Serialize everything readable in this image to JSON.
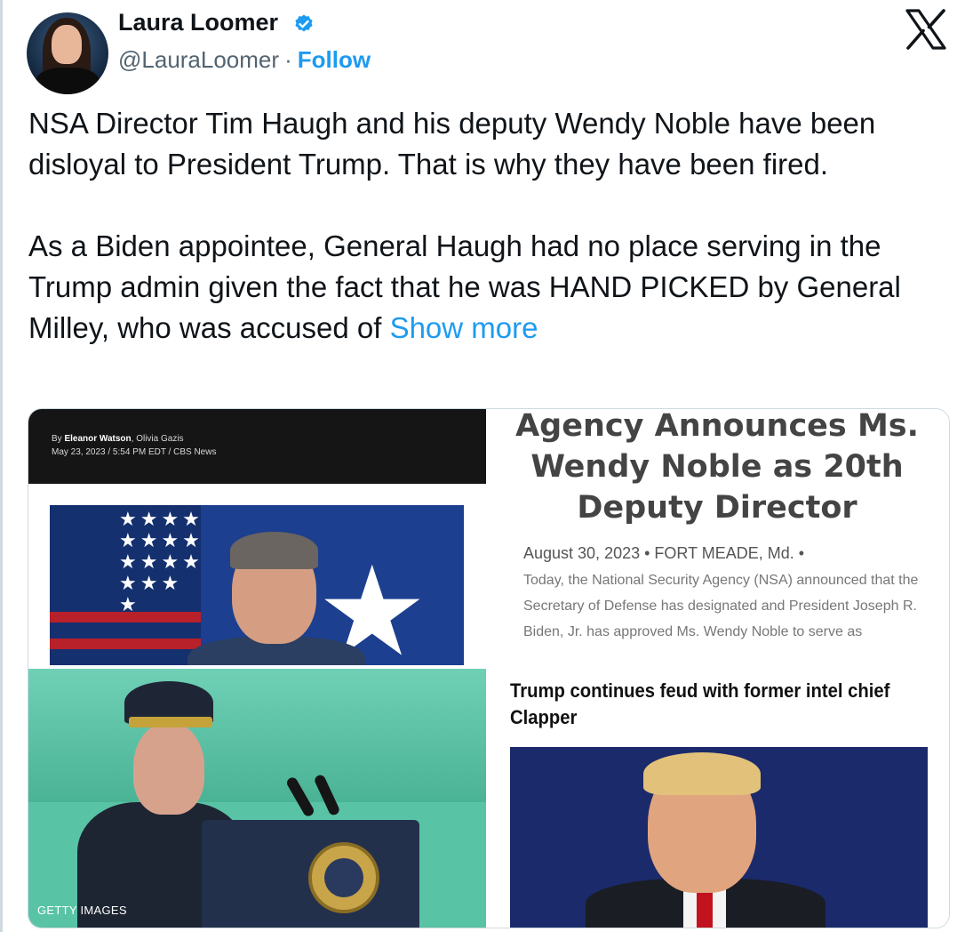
{
  "author": {
    "name": "Laura Loomer",
    "handle": "@LauraLoomer",
    "separator": "·",
    "follow_label": "Follow",
    "verified_icon": "verified-badge-icon",
    "brand_icon": "x-logo-icon",
    "link_color": "#1d9bf0"
  },
  "tweet": {
    "paragraph1": "NSA Director Tim Haugh and his deputy Wendy Noble have been disloyal to President Trump. That is why they have been fired.",
    "paragraph2": "As a Biden appointee, General Haugh had no place serving in the Trump admin given the fact that he was HAND PICKED by General Milley, who was accused of",
    "show_more_label": "Show more"
  },
  "media": {
    "panel1": {
      "byline_prefix": "By",
      "byline_authors": "Eleanor Watson",
      "byline_coauthor": ", Olivia Gazis",
      "dateline": "May 23, 2023 / 5:54 PM EDT / CBS News"
    },
    "panel2": {
      "headline": "Agency Announces Ms. Wendy Noble as 20th Deputy Director",
      "dateline": "August 30, 2023 • FORT MEADE, Md. •",
      "body": "Today, the National Security Agency (NSA) announced that the Secretary of Defense has designated and President Joseph R. Biden, Jr. has approved Ms. Wendy Noble to serve as"
    },
    "panel3": {
      "credit": "GETTY IMAGES"
    },
    "panel4": {
      "headline": "Trump continues feud with former intel chief Clapper"
    }
  }
}
